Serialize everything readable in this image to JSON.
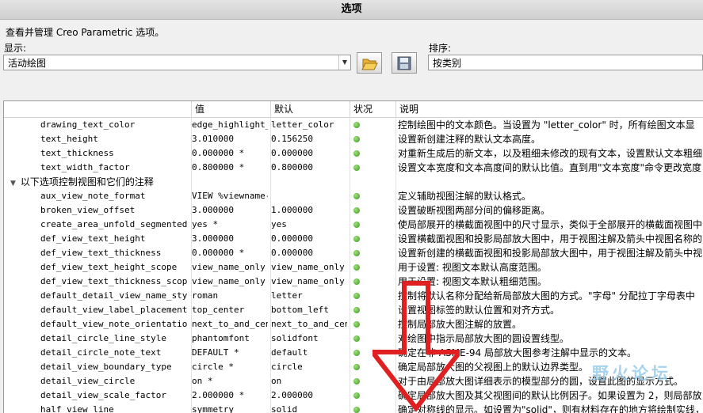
{
  "window": {
    "title": "选项"
  },
  "description": "查看并管理 Creo Parametric 选项。",
  "display": {
    "label": "显示:",
    "value": "活动绘图"
  },
  "sort": {
    "label": "排序:",
    "value": "按类别"
  },
  "toolbar": {
    "open_icon": "folder-open-icon",
    "save_icon": "save-icon"
  },
  "columns": {
    "name": "",
    "value": "值",
    "default": "默认",
    "status": "状况",
    "description": "说明"
  },
  "colors": {
    "status_ok": "#3a9a1e",
    "annotation_arrow": "#e02020",
    "watermark": "#93c9e8"
  },
  "rows": [
    {
      "name": "drawing_text_color",
      "value": "edge_highlight_c",
      "default": "letter_color",
      "desc": "控制绘图中的文本颜色。当设置为 \"letter_color\" 时，所有绘图文本显"
    },
    {
      "name": "text_height",
      "value": "3.010000",
      "default": "0.156250",
      "desc": "设置新创建注释的默认文本高度。"
    },
    {
      "name": "text_thickness",
      "value": "0.000000 *",
      "default": "0.000000",
      "desc": "对重新生成后的新文本，以及粗细未修改的现有文本，设置默认文本粗细"
    },
    {
      "name": "text_width_factor",
      "value": "0.800000 *",
      "default": "0.800000",
      "desc": "设置文本宽度和文本高度间的默认比值。直到用\"文本宽度\"命令更改宽度"
    },
    {
      "group": "以下选项控制视图和它们的注释"
    },
    {
      "name": "aux_view_note_format",
      "value": "VIEW %viewname-%",
      "default": "",
      "desc": "定义辅助视图注解的默认格式。"
    },
    {
      "name": "broken_view_offset",
      "value": "3.000000",
      "default": "1.000000",
      "desc": "设置破断视图两部分间的偏移距离。"
    },
    {
      "name": "create_area_unfold_segmented",
      "value": "yes *",
      "default": "yes",
      "desc": "使局部展开的横截面视图中的尺寸显示，类似于全部展开的横截面视图中"
    },
    {
      "name": "def_view_text_height",
      "value": "3.000000",
      "default": "0.000000",
      "desc": "设置横截面视图和投影局部放大图中，用于视图注解及箭头中视图名称的"
    },
    {
      "name": "def_view_text_thickness",
      "value": "0.000000 *",
      "default": "0.000000",
      "desc": "设置新创建的横截面视图和投影局部放大图中，用于视图注解及箭头中视"
    },
    {
      "name": "def_view_text_height_scope",
      "value": "view_name_only *",
      "default": "view_name_only",
      "desc": "用于设置: 视图文本默认高度范围。"
    },
    {
      "name": "def_view_text_thickness_scope",
      "value": "view_name_only *",
      "default": "view_name_only",
      "desc": "用于设置: 视图文本默认粗细范围。"
    },
    {
      "name": "default_detail_view_name_style",
      "value": "roman",
      "default": "letter",
      "desc": "控制将默认名称分配给新局部放大图的方式。\"字母\" 分配拉丁字母表中"
    },
    {
      "name": "default_view_label_placement",
      "value": "top_center",
      "default": "bottom_left",
      "desc": "设置视图标签的默认位置和对齐方式。"
    },
    {
      "name": "default_view_note_orientation",
      "value": "next_to_and_cent",
      "default": "next_to_and_cent",
      "desc": "控制局部放大图注解的放置。"
    },
    {
      "name": "detail_circle_line_style",
      "value": "phantomfont",
      "default": "solidfont",
      "desc": "对绘图中指示局部放大图的圆设置线型。"
    },
    {
      "name": "detail_circle_note_text",
      "value": "DEFAULT *",
      "default": "default",
      "desc": "确定在非 ASME-94 局部放大图参考注解中显示的文本。"
    },
    {
      "name": "detail_view_boundary_type",
      "value": "circle *",
      "default": "circle",
      "desc": "确定局部放大图的父视图上的默认边界类型。"
    },
    {
      "name": "detail_view_circle",
      "value": "on *",
      "default": "on",
      "desc": "对于由局部放大图详细表示的模型部分的圆，设置此图的显示方式。"
    },
    {
      "name": "detail_view_scale_factor",
      "value": "2.000000 *",
      "default": "2.000000",
      "desc": "确定局部放大图及其父视图间的默认比例因子。如果设置为 2，则局部放"
    },
    {
      "name": "half_view_line",
      "value": "symmetry",
      "default": "solid",
      "desc": "确定对称线的显示。如设置为\"solid\"，则有材料存在的地方将绘制实线，"
    }
  ],
  "watermark": "野火论坛"
}
